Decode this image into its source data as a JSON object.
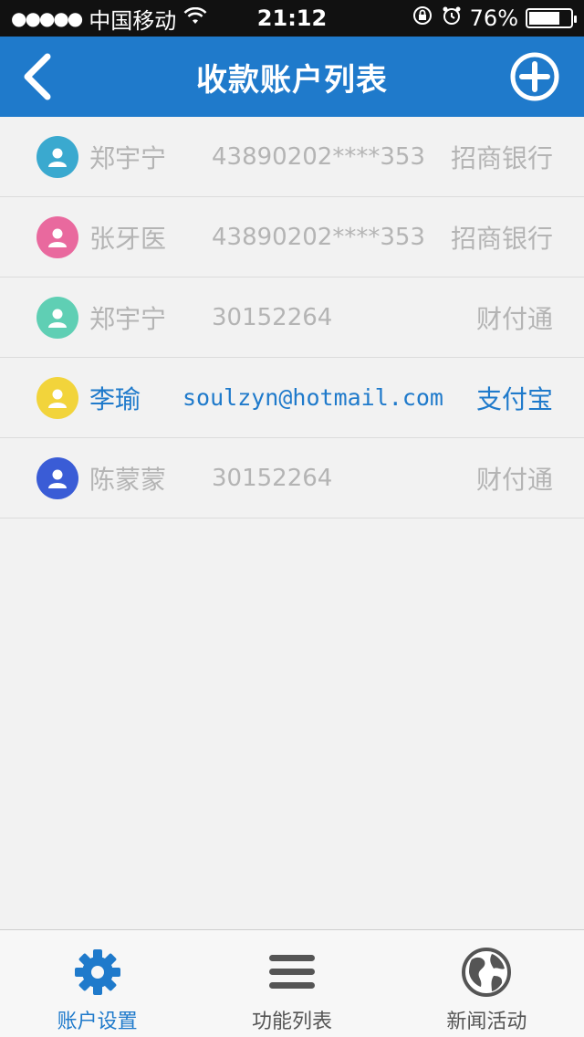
{
  "status_bar": {
    "carrier": "中国移动",
    "time": "21:12",
    "battery_text": "76%",
    "battery_level": 0.76
  },
  "nav": {
    "title": "收款账户列表"
  },
  "accounts": [
    {
      "name": "郑宇宁",
      "number": "43890202****353",
      "bank": "招商银行",
      "avatar_color": "#3aa9cf",
      "active": false
    },
    {
      "name": "张牙医",
      "number": "43890202****353",
      "bank": "招商银行",
      "avatar_color": "#e9699e",
      "active": false
    },
    {
      "name": "郑宇宁",
      "number": "30152264",
      "bank": "财付通",
      "avatar_color": "#5fcfb4",
      "active": false
    },
    {
      "name": "李瑜",
      "number": "soulzyn@hotmail.com",
      "bank": "支付宝",
      "avatar_color": "#f2d43b",
      "active": true
    },
    {
      "name": "陈蒙蒙",
      "number": "30152264",
      "bank": "财付通",
      "avatar_color": "#3a5cd6",
      "active": false
    }
  ],
  "tabs": [
    {
      "label": "账户设置",
      "icon": "gear-icon",
      "active": true
    },
    {
      "label": "功能列表",
      "icon": "menu-icon",
      "active": false
    },
    {
      "label": "新闻活动",
      "icon": "globe-icon",
      "active": false
    }
  ],
  "colors": {
    "accent": "#1f7acb",
    "inactive_text": "#b4b4b4"
  }
}
